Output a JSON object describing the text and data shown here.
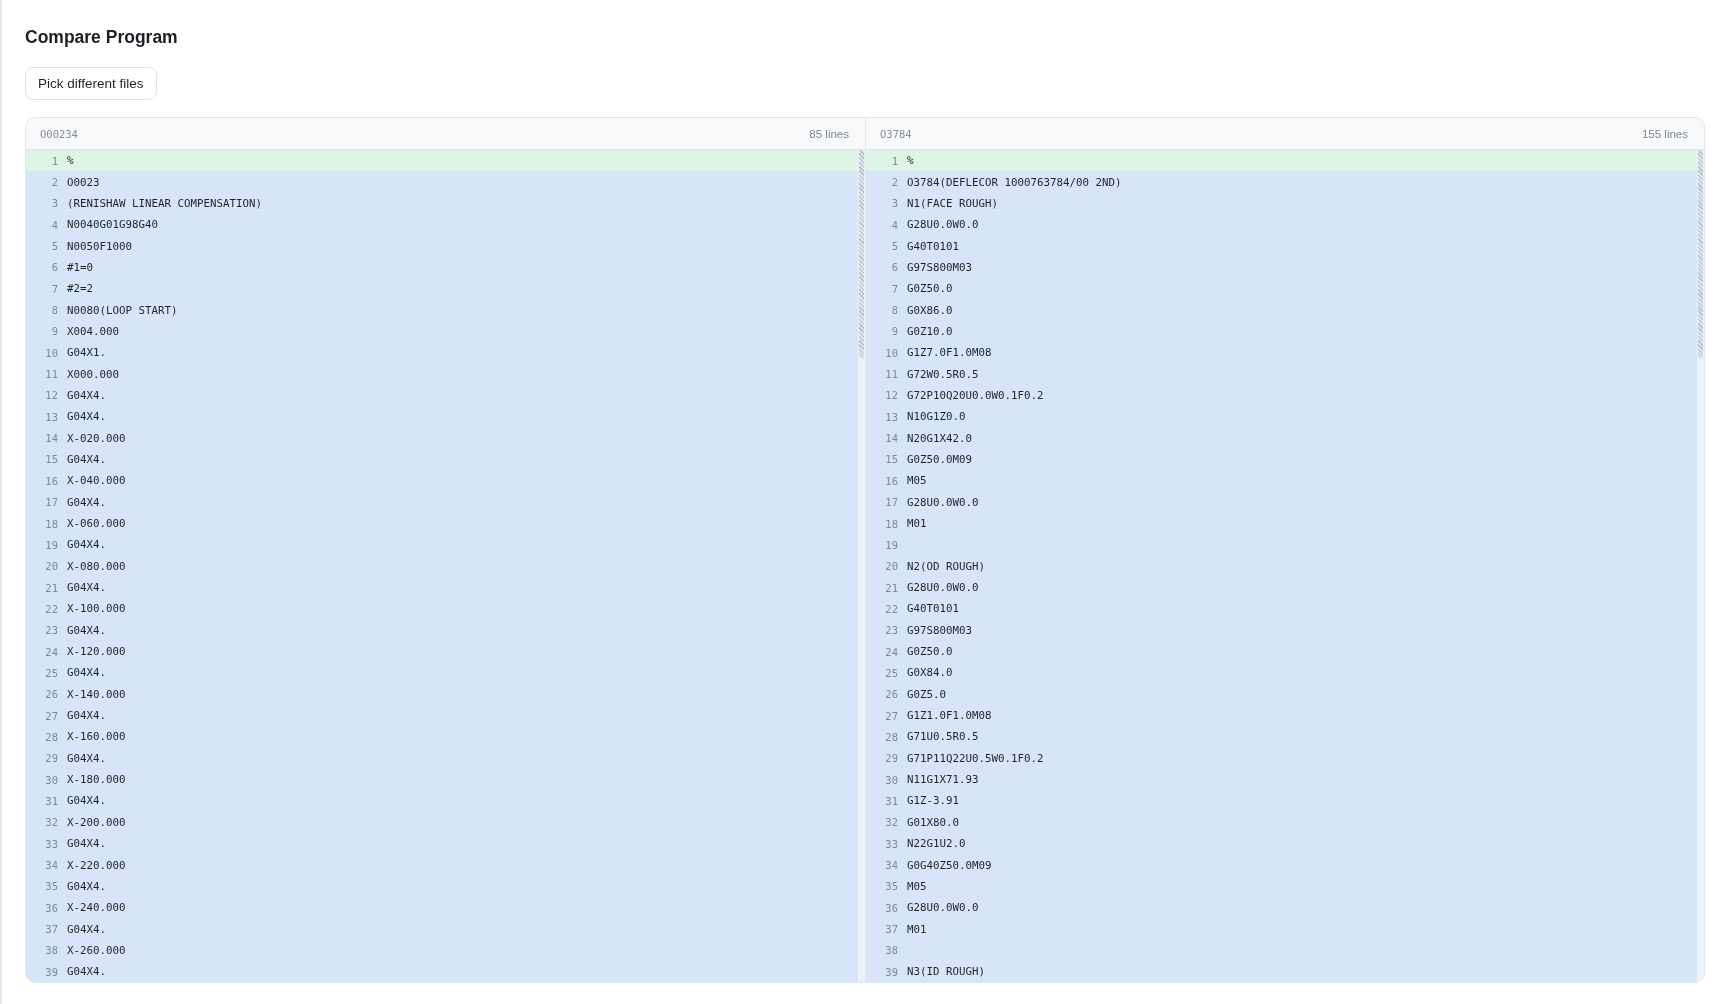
{
  "page": {
    "title": "Compare Program"
  },
  "toolbar": {
    "button": {
      "label": "Pick different files"
    }
  },
  "panes": [
    {
      "file": "O00234",
      "line_count": "85 lines",
      "lines": [
        {
          "number": "1",
          "text": "%",
          "kind": "match"
        },
        {
          "number": "2",
          "text": "O0023",
          "kind": "changed"
        },
        {
          "number": "3",
          "text": "(RENISHAW LINEAR COMPENSATION)",
          "kind": "changed"
        },
        {
          "number": "4",
          "text": "N0040G01G98G40",
          "kind": "changed"
        },
        {
          "number": "5",
          "text": "N0050F1000",
          "kind": "changed"
        },
        {
          "number": "6",
          "text": "#1=0",
          "kind": "changed"
        },
        {
          "number": "7",
          "text": "#2=2",
          "kind": "changed"
        },
        {
          "number": "8",
          "text": "N0080(LOOP START)",
          "kind": "changed"
        },
        {
          "number": "9",
          "text": "X004.000",
          "kind": "changed"
        },
        {
          "number": "10",
          "text": "G04X1.",
          "kind": "changed"
        },
        {
          "number": "11",
          "text": "X000.000",
          "kind": "changed"
        },
        {
          "number": "12",
          "text": "G04X4.",
          "kind": "changed"
        },
        {
          "number": "13",
          "text": "G04X4.",
          "kind": "changed"
        },
        {
          "number": "14",
          "text": "X-020.000",
          "kind": "changed"
        },
        {
          "number": "15",
          "text": "G04X4.",
          "kind": "changed"
        },
        {
          "number": "16",
          "text": "X-040.000",
          "kind": "changed"
        },
        {
          "number": "17",
          "text": "G04X4.",
          "kind": "changed"
        },
        {
          "number": "18",
          "text": "X-060.000",
          "kind": "changed"
        },
        {
          "number": "19",
          "text": "G04X4.",
          "kind": "changed"
        },
        {
          "number": "20",
          "text": "X-080.000",
          "kind": "changed"
        },
        {
          "number": "21",
          "text": "G04X4.",
          "kind": "changed"
        },
        {
          "number": "22",
          "text": "X-100.000",
          "kind": "changed"
        },
        {
          "number": "23",
          "text": "G04X4.",
          "kind": "changed"
        },
        {
          "number": "24",
          "text": "X-120.000",
          "kind": "changed"
        },
        {
          "number": "25",
          "text": "G04X4.",
          "kind": "changed"
        },
        {
          "number": "26",
          "text": "X-140.000",
          "kind": "changed"
        },
        {
          "number": "27",
          "text": "G04X4.",
          "kind": "changed"
        },
        {
          "number": "28",
          "text": "X-160.000",
          "kind": "changed"
        },
        {
          "number": "29",
          "text": "G04X4.",
          "kind": "changed"
        },
        {
          "number": "30",
          "text": "X-180.000",
          "kind": "changed"
        },
        {
          "number": "31",
          "text": "G04X4.",
          "kind": "changed"
        },
        {
          "number": "32",
          "text": "X-200.000",
          "kind": "changed"
        },
        {
          "number": "33",
          "text": "G04X4.",
          "kind": "changed"
        },
        {
          "number": "34",
          "text": "X-220.000",
          "kind": "changed"
        },
        {
          "number": "35",
          "text": "G04X4.",
          "kind": "changed"
        },
        {
          "number": "36",
          "text": "X-240.000",
          "kind": "changed"
        },
        {
          "number": "37",
          "text": "G04X4.",
          "kind": "changed"
        },
        {
          "number": "38",
          "text": "X-260.000",
          "kind": "changed"
        },
        {
          "number": "39",
          "text": "G04X4.",
          "kind": "changed"
        }
      ]
    },
    {
      "file": "O3784",
      "line_count": "155 lines",
      "lines": [
        {
          "number": "1",
          "text": "%",
          "kind": "match"
        },
        {
          "number": "2",
          "text": "O3784(DEFLECOR 1000763784/00 2ND)",
          "kind": "changed"
        },
        {
          "number": "3",
          "text": "N1(FACE ROUGH)",
          "kind": "changed"
        },
        {
          "number": "4",
          "text": "G28U0.0W0.0",
          "kind": "changed"
        },
        {
          "number": "5",
          "text": "G40T0101",
          "kind": "changed"
        },
        {
          "number": "6",
          "text": "G97S800M03",
          "kind": "changed"
        },
        {
          "number": "7",
          "text": "G0Z50.0",
          "kind": "changed"
        },
        {
          "number": "8",
          "text": "G0X86.0",
          "kind": "changed"
        },
        {
          "number": "9",
          "text": "G0Z10.0",
          "kind": "changed"
        },
        {
          "number": "10",
          "text": "G1Z7.0F1.0M08",
          "kind": "changed"
        },
        {
          "number": "11",
          "text": "G72W0.5R0.5",
          "kind": "changed"
        },
        {
          "number": "12",
          "text": "G72P10Q20U0.0W0.1F0.2",
          "kind": "changed"
        },
        {
          "number": "13",
          "text": "N10G1Z0.0",
          "kind": "changed"
        },
        {
          "number": "14",
          "text": "N20G1X42.0",
          "kind": "changed"
        },
        {
          "number": "15",
          "text": "G0Z50.0M09",
          "kind": "changed"
        },
        {
          "number": "16",
          "text": "M05",
          "kind": "changed"
        },
        {
          "number": "17",
          "text": "G28U0.0W0.0",
          "kind": "changed"
        },
        {
          "number": "18",
          "text": "M01",
          "kind": "changed"
        },
        {
          "number": "19",
          "kind": "changed"
        },
        {
          "number": "20",
          "text": "N2(OD ROUGH)",
          "kind": "changed"
        },
        {
          "number": "21",
          "text": "G28U0.0W0.0",
          "kind": "changed"
        },
        {
          "number": "22",
          "text": "G40T0101",
          "kind": "changed"
        },
        {
          "number": "23",
          "text": "G97S800M03",
          "kind": "changed"
        },
        {
          "number": "24",
          "text": "G0Z50.0",
          "kind": "changed"
        },
        {
          "number": "25",
          "text": "G0X84.0",
          "kind": "changed"
        },
        {
          "number": "26",
          "text": "G0Z5.0",
          "kind": "changed"
        },
        {
          "number": "27",
          "text": "G1Z1.0F1.0M08",
          "kind": "changed"
        },
        {
          "number": "28",
          "text": "G71U0.5R0.5",
          "kind": "changed"
        },
        {
          "number": "29",
          "text": "G71P11Q22U0.5W0.1F0.2",
          "kind": "changed"
        },
        {
          "number": "30",
          "text": "N11G1X71.93",
          "kind": "changed"
        },
        {
          "number": "31",
          "text": "G1Z-3.91",
          "kind": "changed"
        },
        {
          "number": "32",
          "text": "G01X80.0",
          "kind": "changed"
        },
        {
          "number": "33",
          "text": "N22G1U2.0",
          "kind": "changed"
        },
        {
          "number": "34",
          "text": "G0G40Z50.0M09",
          "kind": "changed"
        },
        {
          "number": "35",
          "text": "M05",
          "kind": "changed"
        },
        {
          "number": "36",
          "text": "G28U0.0W0.0",
          "kind": "changed"
        },
        {
          "number": "37",
          "text": "M01",
          "kind": "changed"
        },
        {
          "number": "38",
          "kind": "changed"
        },
        {
          "number": "39",
          "text": "N3(ID ROUGH)",
          "kind": "changed"
        }
      ]
    }
  ]
}
